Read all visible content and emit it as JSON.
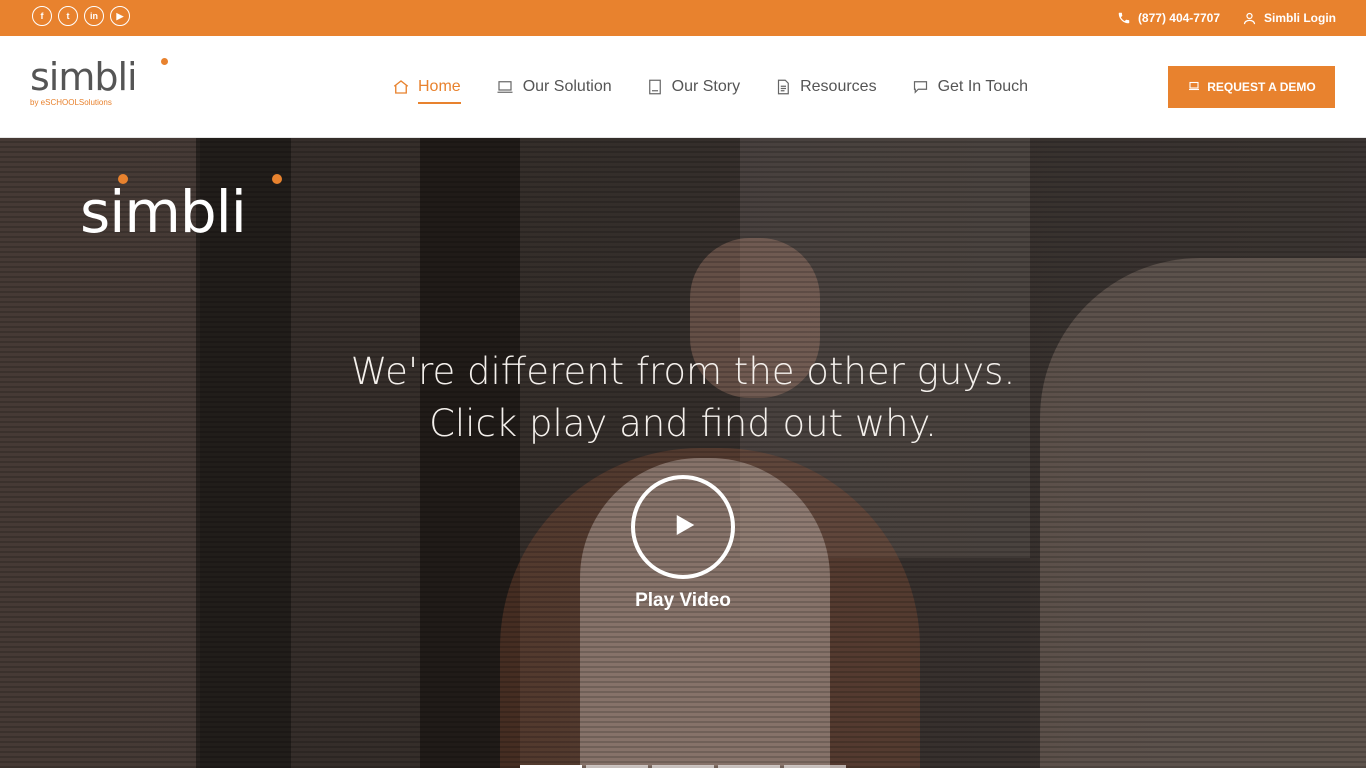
{
  "topbar": {
    "social": [
      {
        "icon": "facebook-icon",
        "glyph": "f"
      },
      {
        "icon": "twitter-icon",
        "glyph": "t"
      },
      {
        "icon": "linkedin-icon",
        "glyph": "in"
      },
      {
        "icon": "youtube-icon",
        "glyph": "▶"
      }
    ],
    "phone": "(877) 404-7707",
    "login": "Simbli Login"
  },
  "header": {
    "logo_word": "simbli",
    "logo_tagline": "by eSCHOOLSolutions",
    "nav": [
      {
        "label": "Home",
        "icon": "home-icon",
        "active": true
      },
      {
        "label": "Our Solution",
        "icon": "laptop-icon",
        "active": false
      },
      {
        "label": "Our Story",
        "icon": "book-icon",
        "active": false
      },
      {
        "label": "Resources",
        "icon": "document-icon",
        "active": false
      },
      {
        "label": "Get In Touch",
        "icon": "chat-icon",
        "active": false
      }
    ],
    "demo_button": "REQUEST A DEMO"
  },
  "hero": {
    "logo_word": "simbli",
    "headline_1": "We're different from the other guys.",
    "headline_2": "Click play and find out why.",
    "play_label": "Play Video",
    "slides": 5,
    "active_slide": 1
  },
  "colors": {
    "accent": "#e8822e",
    "text_gray": "#555555"
  }
}
